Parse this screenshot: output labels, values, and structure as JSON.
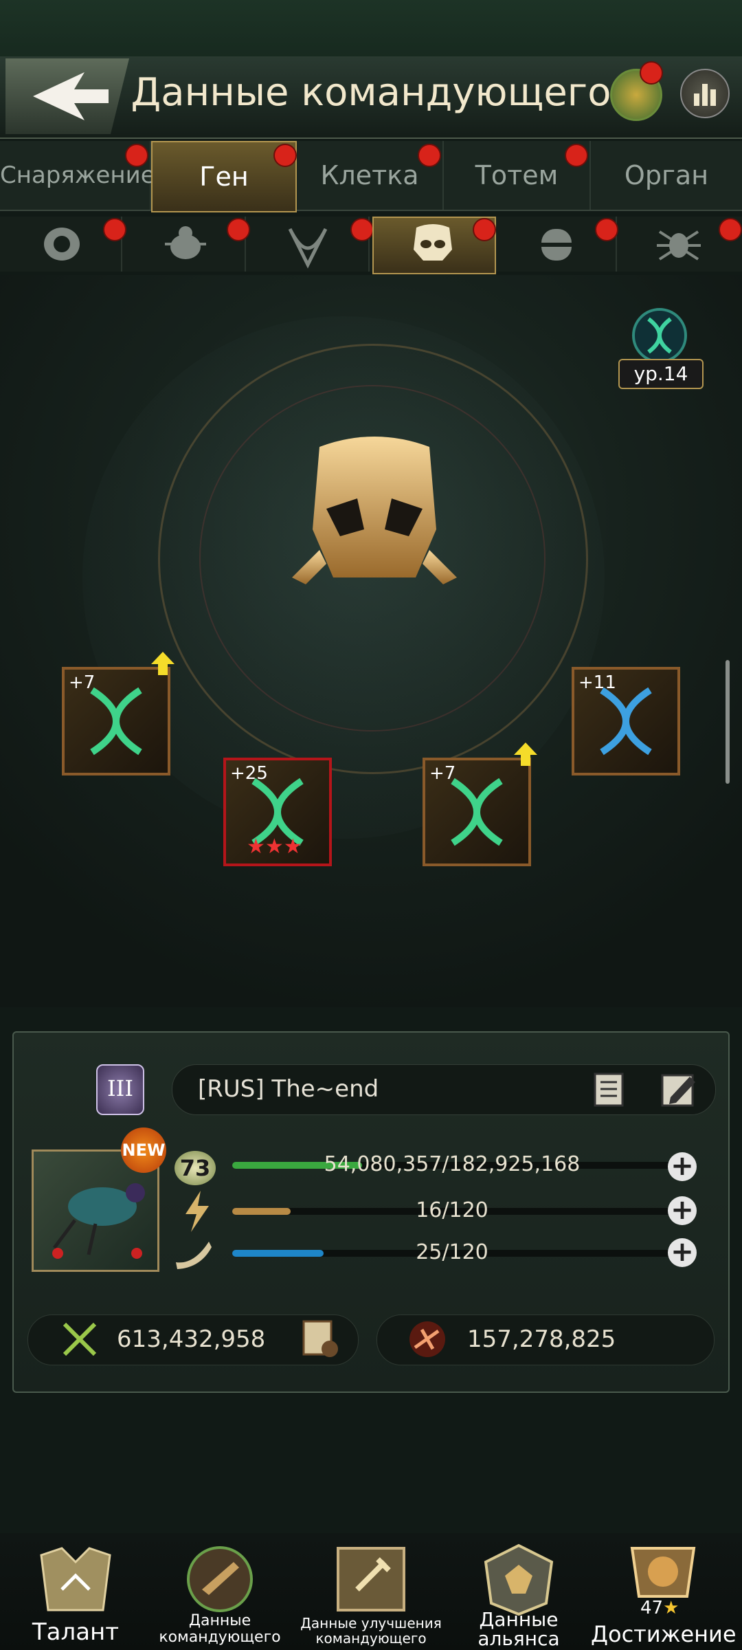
{
  "header": {
    "title": "Данные командующего"
  },
  "tabs": [
    {
      "label": "Снаряжение",
      "notify": true
    },
    {
      "label": "Ген",
      "notify": true,
      "active": true
    },
    {
      "label": "Клетка",
      "notify": true
    },
    {
      "label": "Тотем",
      "notify": true
    },
    {
      "label": "Орган",
      "notify": true
    }
  ],
  "subtabs": [
    {
      "icon": "beetle-mask-icon",
      "notify": true
    },
    {
      "icon": "bug-icon",
      "notify": true
    },
    {
      "icon": "mantis-head-icon",
      "notify": true
    },
    {
      "icon": "skull-mask-icon",
      "notify": true,
      "active": true
    },
    {
      "icon": "helmet-icon",
      "notify": true
    },
    {
      "icon": "spider-icon",
      "notify": true
    }
  ],
  "gene_panel": {
    "level_badge": "ур.14",
    "slots": [
      {
        "level": "+7",
        "frame": "orange",
        "upgrade": true,
        "color": "green"
      },
      {
        "level": "+25",
        "frame": "red",
        "stars": 3,
        "color": "green"
      },
      {
        "level": "+7",
        "frame": "orange",
        "upgrade": true,
        "color": "green"
      },
      {
        "level": "+11",
        "frame": "orange",
        "upgrade": false,
        "color": "blue"
      }
    ]
  },
  "player": {
    "name": "[RUS]  The~end",
    "rank": "III",
    "avatar_badge": "NEW",
    "level": "73",
    "exp": "54,080,357/182,925,168",
    "exp_fraction": 0.296,
    "energy": "16/120",
    "energy_fraction": 0.133,
    "horn": "25/120",
    "horn_fraction": 0.208,
    "power": "613,432,958",
    "kills": "157,278,825"
  },
  "colors": {
    "exp": "#3aa83f",
    "energy": "#b88a45",
    "horn": "#1e86c9",
    "accent": "#b39650"
  },
  "bottom_nav": [
    {
      "label": "Талант"
    },
    {
      "label": "Данные\nкомандующего"
    },
    {
      "label": "Данные улучшения\nкомандующего"
    },
    {
      "label": "Данные\nальянса"
    },
    {
      "label": "Достижение",
      "badge": "47"
    }
  ]
}
